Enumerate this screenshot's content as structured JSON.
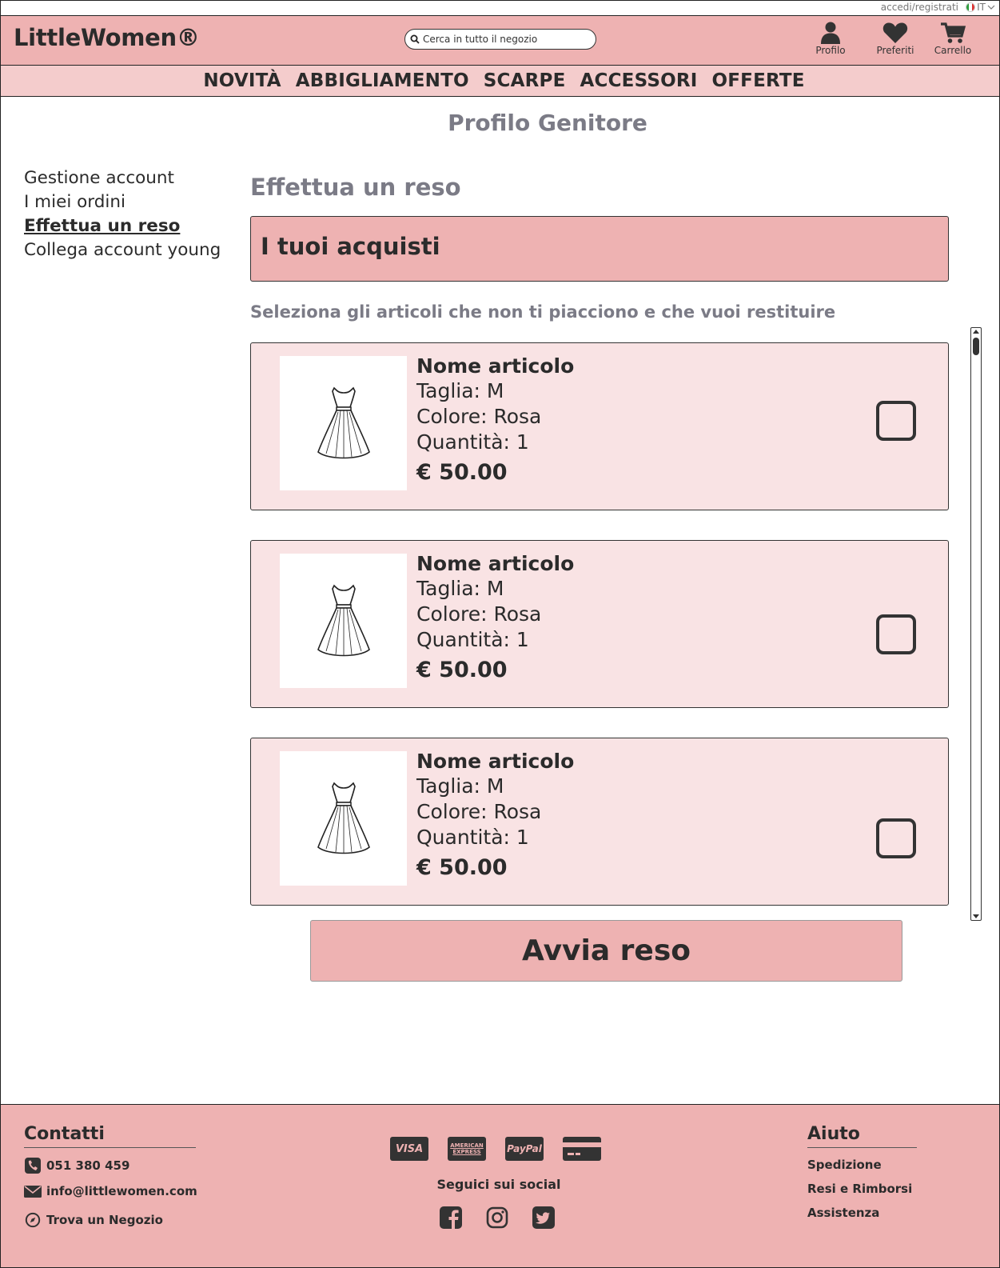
{
  "topbar": {
    "login_link": "accedi/registrati",
    "language": "IT"
  },
  "header": {
    "logo": "LittleWomen®",
    "search_placeholder": "Cerca in tutto il negozio",
    "icons": {
      "profile": "Profilo",
      "favorites": "Preferiti",
      "cart": "Carrello"
    }
  },
  "nav": {
    "items": [
      "NOVITÀ",
      "ABBIGLIAMENTO",
      "SCARPE",
      "ACCESSORI",
      "OFFERTE"
    ]
  },
  "page": {
    "title": "Profilo Genitore"
  },
  "sidebar": {
    "items": [
      {
        "label": "Gestione account"
      },
      {
        "label": "I miei ordini"
      },
      {
        "label": "Effettua un reso"
      },
      {
        "label": "Collega account young"
      }
    ]
  },
  "main": {
    "section_title": "Effettua un reso",
    "purchases_heading": "I tuoi acquisti",
    "instruction": "Seleziona gli articoli che non ti piacciono e che vuoi restituire",
    "items": [
      {
        "name": "Nome articolo",
        "size": "Taglia: M",
        "color": "Colore: Rosa",
        "qty": "Quantità: 1",
        "price": "€ 50.00"
      },
      {
        "name": "Nome articolo",
        "size": "Taglia: M",
        "color": "Colore: Rosa",
        "qty": "Quantità: 1",
        "price": "€ 50.00"
      },
      {
        "name": "Nome articolo",
        "size": "Taglia: M",
        "color": "Colore: Rosa",
        "qty": "Quantità: 1",
        "price": "€ 50.00"
      }
    ],
    "submit_label": "Avvia reso"
  },
  "footer": {
    "contacts_title": "Contatti",
    "phone": "051 380 459",
    "email": "info@littlewomen.com",
    "store": "Trova un Negozio",
    "payments": [
      "VISA",
      "AMERICAN EXPRESS",
      "PayPal",
      "card-icon"
    ],
    "social_label": "Seguici sui social",
    "help_title": "Aiuto",
    "help_links": [
      "Spedizione",
      "Resi e Rimborsi",
      "Assistenza"
    ]
  },
  "colors": {
    "header_bg": "#eeb2b2",
    "nav_bg": "#f4cccc",
    "item_bg": "#f9e3e4",
    "muted_text": "#7b7b86",
    "dark": "#2b2b2b"
  }
}
